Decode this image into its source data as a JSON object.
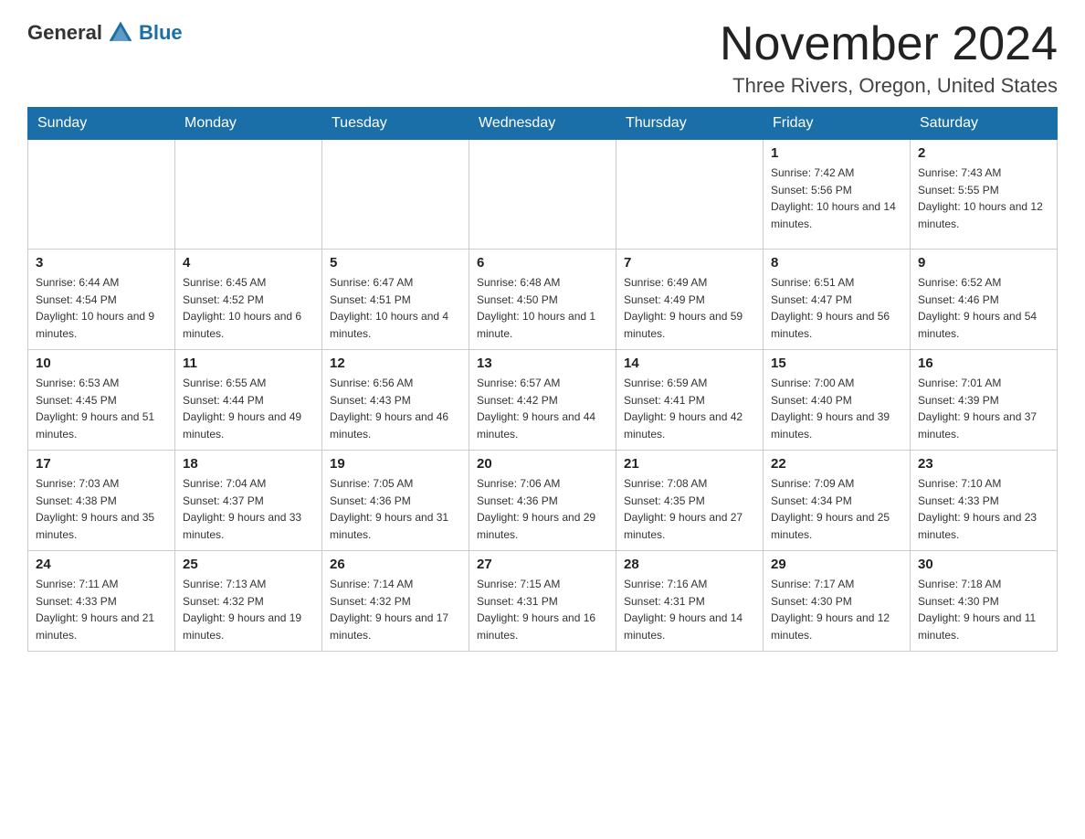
{
  "logo": {
    "text_general": "General",
    "text_blue": "Blue"
  },
  "header": {
    "month_title": "November 2024",
    "location": "Three Rivers, Oregon, United States"
  },
  "weekdays": [
    "Sunday",
    "Monday",
    "Tuesday",
    "Wednesday",
    "Thursday",
    "Friday",
    "Saturday"
  ],
  "weeks": [
    [
      {
        "day": "",
        "sunrise": "",
        "sunset": "",
        "daylight": ""
      },
      {
        "day": "",
        "sunrise": "",
        "sunset": "",
        "daylight": ""
      },
      {
        "day": "",
        "sunrise": "",
        "sunset": "",
        "daylight": ""
      },
      {
        "day": "",
        "sunrise": "",
        "sunset": "",
        "daylight": ""
      },
      {
        "day": "",
        "sunrise": "",
        "sunset": "",
        "daylight": ""
      },
      {
        "day": "1",
        "sunrise": "Sunrise: 7:42 AM",
        "sunset": "Sunset: 5:56 PM",
        "daylight": "Daylight: 10 hours and 14 minutes."
      },
      {
        "day": "2",
        "sunrise": "Sunrise: 7:43 AM",
        "sunset": "Sunset: 5:55 PM",
        "daylight": "Daylight: 10 hours and 12 minutes."
      }
    ],
    [
      {
        "day": "3",
        "sunrise": "Sunrise: 6:44 AM",
        "sunset": "Sunset: 4:54 PM",
        "daylight": "Daylight: 10 hours and 9 minutes."
      },
      {
        "day": "4",
        "sunrise": "Sunrise: 6:45 AM",
        "sunset": "Sunset: 4:52 PM",
        "daylight": "Daylight: 10 hours and 6 minutes."
      },
      {
        "day": "5",
        "sunrise": "Sunrise: 6:47 AM",
        "sunset": "Sunset: 4:51 PM",
        "daylight": "Daylight: 10 hours and 4 minutes."
      },
      {
        "day": "6",
        "sunrise": "Sunrise: 6:48 AM",
        "sunset": "Sunset: 4:50 PM",
        "daylight": "Daylight: 10 hours and 1 minute."
      },
      {
        "day": "7",
        "sunrise": "Sunrise: 6:49 AM",
        "sunset": "Sunset: 4:49 PM",
        "daylight": "Daylight: 9 hours and 59 minutes."
      },
      {
        "day": "8",
        "sunrise": "Sunrise: 6:51 AM",
        "sunset": "Sunset: 4:47 PM",
        "daylight": "Daylight: 9 hours and 56 minutes."
      },
      {
        "day": "9",
        "sunrise": "Sunrise: 6:52 AM",
        "sunset": "Sunset: 4:46 PM",
        "daylight": "Daylight: 9 hours and 54 minutes."
      }
    ],
    [
      {
        "day": "10",
        "sunrise": "Sunrise: 6:53 AM",
        "sunset": "Sunset: 4:45 PM",
        "daylight": "Daylight: 9 hours and 51 minutes."
      },
      {
        "day": "11",
        "sunrise": "Sunrise: 6:55 AM",
        "sunset": "Sunset: 4:44 PM",
        "daylight": "Daylight: 9 hours and 49 minutes."
      },
      {
        "day": "12",
        "sunrise": "Sunrise: 6:56 AM",
        "sunset": "Sunset: 4:43 PM",
        "daylight": "Daylight: 9 hours and 46 minutes."
      },
      {
        "day": "13",
        "sunrise": "Sunrise: 6:57 AM",
        "sunset": "Sunset: 4:42 PM",
        "daylight": "Daylight: 9 hours and 44 minutes."
      },
      {
        "day": "14",
        "sunrise": "Sunrise: 6:59 AM",
        "sunset": "Sunset: 4:41 PM",
        "daylight": "Daylight: 9 hours and 42 minutes."
      },
      {
        "day": "15",
        "sunrise": "Sunrise: 7:00 AM",
        "sunset": "Sunset: 4:40 PM",
        "daylight": "Daylight: 9 hours and 39 minutes."
      },
      {
        "day": "16",
        "sunrise": "Sunrise: 7:01 AM",
        "sunset": "Sunset: 4:39 PM",
        "daylight": "Daylight: 9 hours and 37 minutes."
      }
    ],
    [
      {
        "day": "17",
        "sunrise": "Sunrise: 7:03 AM",
        "sunset": "Sunset: 4:38 PM",
        "daylight": "Daylight: 9 hours and 35 minutes."
      },
      {
        "day": "18",
        "sunrise": "Sunrise: 7:04 AM",
        "sunset": "Sunset: 4:37 PM",
        "daylight": "Daylight: 9 hours and 33 minutes."
      },
      {
        "day": "19",
        "sunrise": "Sunrise: 7:05 AM",
        "sunset": "Sunset: 4:36 PM",
        "daylight": "Daylight: 9 hours and 31 minutes."
      },
      {
        "day": "20",
        "sunrise": "Sunrise: 7:06 AM",
        "sunset": "Sunset: 4:36 PM",
        "daylight": "Daylight: 9 hours and 29 minutes."
      },
      {
        "day": "21",
        "sunrise": "Sunrise: 7:08 AM",
        "sunset": "Sunset: 4:35 PM",
        "daylight": "Daylight: 9 hours and 27 minutes."
      },
      {
        "day": "22",
        "sunrise": "Sunrise: 7:09 AM",
        "sunset": "Sunset: 4:34 PM",
        "daylight": "Daylight: 9 hours and 25 minutes."
      },
      {
        "day": "23",
        "sunrise": "Sunrise: 7:10 AM",
        "sunset": "Sunset: 4:33 PM",
        "daylight": "Daylight: 9 hours and 23 minutes."
      }
    ],
    [
      {
        "day": "24",
        "sunrise": "Sunrise: 7:11 AM",
        "sunset": "Sunset: 4:33 PM",
        "daylight": "Daylight: 9 hours and 21 minutes."
      },
      {
        "day": "25",
        "sunrise": "Sunrise: 7:13 AM",
        "sunset": "Sunset: 4:32 PM",
        "daylight": "Daylight: 9 hours and 19 minutes."
      },
      {
        "day": "26",
        "sunrise": "Sunrise: 7:14 AM",
        "sunset": "Sunset: 4:32 PM",
        "daylight": "Daylight: 9 hours and 17 minutes."
      },
      {
        "day": "27",
        "sunrise": "Sunrise: 7:15 AM",
        "sunset": "Sunset: 4:31 PM",
        "daylight": "Daylight: 9 hours and 16 minutes."
      },
      {
        "day": "28",
        "sunrise": "Sunrise: 7:16 AM",
        "sunset": "Sunset: 4:31 PM",
        "daylight": "Daylight: 9 hours and 14 minutes."
      },
      {
        "day": "29",
        "sunrise": "Sunrise: 7:17 AM",
        "sunset": "Sunset: 4:30 PM",
        "daylight": "Daylight: 9 hours and 12 minutes."
      },
      {
        "day": "30",
        "sunrise": "Sunrise: 7:18 AM",
        "sunset": "Sunset: 4:30 PM",
        "daylight": "Daylight: 9 hours and 11 minutes."
      }
    ]
  ]
}
